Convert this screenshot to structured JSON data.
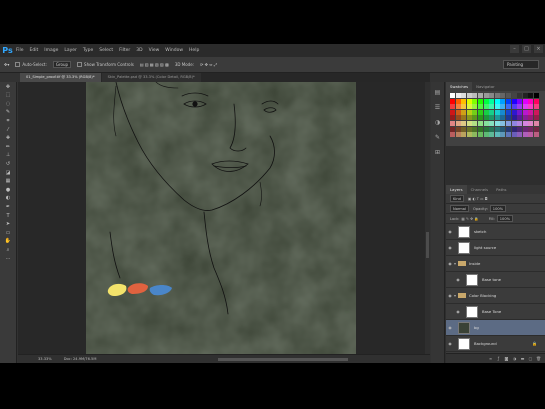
{
  "menubar": {
    "logo": "Ps",
    "items": [
      "File",
      "Edit",
      "Image",
      "Layer",
      "Type",
      "Select",
      "Filter",
      "3D",
      "View",
      "Window",
      "Help"
    ],
    "controls": [
      "–",
      "□",
      "×"
    ]
  },
  "options": {
    "auto_select_label": "Auto-Select:",
    "auto_select_value": "Group",
    "show_transform_label": "Show Transform Controls",
    "mode_3d": "3D Mode:",
    "workspace": "Painting"
  },
  "tabs": [
    {
      "label": "01_Simple_proof.tif @ 33.3% (RGB/8)*"
    },
    {
      "label": "Skin_Palette.psd @ 33.3% (Color Detail, RGB/8)*"
    }
  ],
  "status": {
    "zoom": "33.33%",
    "docsize": "Doc: 24.9M/76.5M"
  },
  "panels": {
    "swatches_tabs": [
      "Swatches",
      "Navigator"
    ],
    "layers_tabs": [
      "Layers",
      "Channels",
      "Paths"
    ],
    "kind_label": "Kind",
    "blend_mode": "Normal",
    "opacity_label": "Opacity:",
    "opacity_value": "100%",
    "lock_label": "Lock:",
    "fill_label": "Fill:",
    "fill_value": "100%",
    "layers": [
      {
        "name": "sketch",
        "type": "layer",
        "thumb": "white",
        "selected": false
      },
      {
        "name": "light source",
        "type": "layer",
        "thumb": "white",
        "selected": false
      },
      {
        "name": "Inside",
        "type": "group",
        "selected": false
      },
      {
        "name": "Base tone",
        "type": "layer",
        "thumb": "white",
        "selected": false
      },
      {
        "name": "Color Blocking",
        "type": "group",
        "selected": false
      },
      {
        "name": "Base Tone",
        "type": "layer",
        "thumb": "white",
        "selected": false
      },
      {
        "name": "bg",
        "type": "layer",
        "thumb": "dark",
        "selected": true
      },
      {
        "name": "Background",
        "type": "layer",
        "thumb": "white",
        "selected": false,
        "locked": true
      }
    ]
  },
  "colors": {
    "foreground": "#e07a5f",
    "background": "#ffffff",
    "canvas": "#3c4436",
    "paint_yellow": "#f3e36b",
    "paint_orange": "#e0623f",
    "paint_blue": "#4a86c9"
  }
}
